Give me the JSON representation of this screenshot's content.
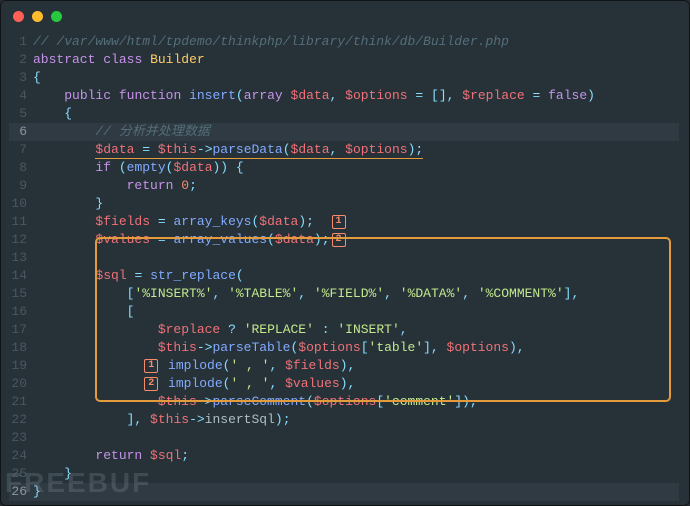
{
  "watermark": "FREEBUF",
  "lines": [
    {
      "n": 1,
      "tokens": [
        [
          "cmt",
          "// /var/www/html/tpdemo/thinkphp/library/think/db/Builder.php"
        ]
      ]
    },
    {
      "n": 2,
      "tokens": [
        [
          "kw",
          "abstract"
        ],
        [
          "txt",
          " "
        ],
        [
          "kw",
          "class"
        ],
        [
          "txt",
          " "
        ],
        [
          "cls",
          "Builder"
        ]
      ]
    },
    {
      "n": 3,
      "tokens": [
        [
          "pun",
          "{"
        ]
      ]
    },
    {
      "n": 4,
      "tokens": [
        [
          "txt",
          "    "
        ],
        [
          "kw",
          "public"
        ],
        [
          "txt",
          " "
        ],
        [
          "kw",
          "function"
        ],
        [
          "txt",
          " "
        ],
        [
          "fn",
          "insert"
        ],
        [
          "pun",
          "("
        ],
        [
          "kw",
          "array"
        ],
        [
          "txt",
          " "
        ],
        [
          "var",
          "$data"
        ],
        [
          "pun",
          ","
        ],
        [
          "txt",
          " "
        ],
        [
          "var",
          "$options"
        ],
        [
          "txt",
          " "
        ],
        [
          "op",
          "="
        ],
        [
          "txt",
          " "
        ],
        [
          "pun",
          "[]"
        ],
        [
          "pun",
          ","
        ],
        [
          "txt",
          " "
        ],
        [
          "var",
          "$replace"
        ],
        [
          "txt",
          " "
        ],
        [
          "op",
          "="
        ],
        [
          "txt",
          " "
        ],
        [
          "kw",
          "false"
        ],
        [
          "pun",
          ")"
        ]
      ]
    },
    {
      "n": 5,
      "tokens": [
        [
          "txt",
          "    "
        ],
        [
          "pun",
          "{"
        ]
      ]
    },
    {
      "n": 6,
      "active": true,
      "tokens": [
        [
          "txt",
          "        "
        ],
        [
          "cmt",
          "// 分析并处理数据"
        ]
      ]
    },
    {
      "n": 7,
      "tokens": [
        [
          "txt",
          "        "
        ],
        [
          "ul_start",
          ""
        ],
        [
          "var",
          "$data"
        ],
        [
          "txt",
          " "
        ],
        [
          "op",
          "="
        ],
        [
          "txt",
          " "
        ],
        [
          "var",
          "$this"
        ],
        [
          "op",
          "->"
        ],
        [
          "fn",
          "parseData"
        ],
        [
          "pun",
          "("
        ],
        [
          "var",
          "$data"
        ],
        [
          "pun",
          ","
        ],
        [
          "txt",
          " "
        ],
        [
          "var",
          "$options"
        ],
        [
          "pun",
          ")"
        ],
        [
          "pun",
          ";"
        ],
        [
          "ul_end",
          ""
        ]
      ]
    },
    {
      "n": 8,
      "tokens": [
        [
          "txt",
          "        "
        ],
        [
          "kw",
          "if"
        ],
        [
          "txt",
          " "
        ],
        [
          "pun",
          "("
        ],
        [
          "fn",
          "empty"
        ],
        [
          "pun",
          "("
        ],
        [
          "var",
          "$data"
        ],
        [
          "pun",
          "))"
        ],
        [
          "txt",
          " "
        ],
        [
          "pun",
          "{"
        ]
      ]
    },
    {
      "n": 9,
      "tokens": [
        [
          "txt",
          "            "
        ],
        [
          "kw",
          "return"
        ],
        [
          "txt",
          " "
        ],
        [
          "num",
          "0"
        ],
        [
          "pun",
          ";"
        ]
      ]
    },
    {
      "n": 10,
      "tokens": [
        [
          "txt",
          "        "
        ],
        [
          "pun",
          "}"
        ]
      ]
    },
    {
      "n": 11,
      "tokens": [
        [
          "txt",
          "        "
        ],
        [
          "var",
          "$fields"
        ],
        [
          "txt",
          " "
        ],
        [
          "op",
          "="
        ],
        [
          "txt",
          " "
        ],
        [
          "fn",
          "array_keys"
        ],
        [
          "pun",
          "("
        ],
        [
          "var",
          "$data"
        ],
        [
          "pun",
          ")"
        ],
        [
          "pun",
          ";"
        ],
        [
          "txt",
          "  "
        ],
        [
          "marker",
          "1"
        ]
      ]
    },
    {
      "n": 12,
      "tokens": [
        [
          "txt",
          "        "
        ],
        [
          "var",
          "$values"
        ],
        [
          "txt",
          " "
        ],
        [
          "op",
          "="
        ],
        [
          "txt",
          " "
        ],
        [
          "fn",
          "array_values"
        ],
        [
          "pun",
          "("
        ],
        [
          "var",
          "$data"
        ],
        [
          "pun",
          ")"
        ],
        [
          "pun",
          ";"
        ],
        [
          "marker",
          "2"
        ]
      ]
    },
    {
      "n": 13,
      "tokens": [
        [
          "txt",
          " "
        ]
      ]
    },
    {
      "n": 14,
      "tokens": [
        [
          "txt",
          "        "
        ],
        [
          "var",
          "$sql"
        ],
        [
          "txt",
          " "
        ],
        [
          "op",
          "="
        ],
        [
          "txt",
          " "
        ],
        [
          "fn",
          "str_replace"
        ],
        [
          "pun",
          "("
        ]
      ]
    },
    {
      "n": 15,
      "tokens": [
        [
          "txt",
          "            "
        ],
        [
          "pun",
          "["
        ],
        [
          "str",
          "'%INSERT%'"
        ],
        [
          "pun",
          ","
        ],
        [
          "txt",
          " "
        ],
        [
          "str",
          "'%TABLE%'"
        ],
        [
          "pun",
          ","
        ],
        [
          "txt",
          " "
        ],
        [
          "str",
          "'%FIELD%'"
        ],
        [
          "pun",
          ","
        ],
        [
          "txt",
          " "
        ],
        [
          "str",
          "'%DATA%'"
        ],
        [
          "pun",
          ","
        ],
        [
          "txt",
          " "
        ],
        [
          "str",
          "'%COMMENT%'"
        ],
        [
          "pun",
          "],"
        ]
      ]
    },
    {
      "n": 16,
      "tokens": [
        [
          "txt",
          "            "
        ],
        [
          "pun",
          "["
        ]
      ]
    },
    {
      "n": 17,
      "tokens": [
        [
          "txt",
          "                "
        ],
        [
          "var",
          "$replace"
        ],
        [
          "txt",
          " "
        ],
        [
          "op",
          "?"
        ],
        [
          "txt",
          " "
        ],
        [
          "str",
          "'REPLACE'"
        ],
        [
          "txt",
          " "
        ],
        [
          "op",
          ":"
        ],
        [
          "txt",
          " "
        ],
        [
          "str",
          "'INSERT'"
        ],
        [
          "pun",
          ","
        ]
      ]
    },
    {
      "n": 18,
      "tokens": [
        [
          "txt",
          "                "
        ],
        [
          "var",
          "$this"
        ],
        [
          "op",
          "->"
        ],
        [
          "fn",
          "parseTable"
        ],
        [
          "pun",
          "("
        ],
        [
          "var",
          "$options"
        ],
        [
          "pun",
          "["
        ],
        [
          "str",
          "'table'"
        ],
        [
          "pun",
          "],"
        ],
        [
          "txt",
          " "
        ],
        [
          "var",
          "$options"
        ],
        [
          "pun",
          "),"
        ]
      ]
    },
    {
      "n": 19,
      "tokens": [
        [
          "txt",
          "              "
        ],
        [
          "marker",
          "1"
        ],
        [
          "txt",
          " "
        ],
        [
          "fn",
          "implode"
        ],
        [
          "pun",
          "("
        ],
        [
          "str",
          "' , '"
        ],
        [
          "pun",
          ","
        ],
        [
          "txt",
          " "
        ],
        [
          "var",
          "$fields"
        ],
        [
          "pun",
          "),"
        ]
      ]
    },
    {
      "n": 20,
      "tokens": [
        [
          "txt",
          "              "
        ],
        [
          "marker",
          "2"
        ],
        [
          "txt",
          " "
        ],
        [
          "fn",
          "implode"
        ],
        [
          "pun",
          "("
        ],
        [
          "str",
          "' , '"
        ],
        [
          "pun",
          ","
        ],
        [
          "txt",
          " "
        ],
        [
          "var",
          "$values"
        ],
        [
          "pun",
          "),"
        ]
      ]
    },
    {
      "n": 21,
      "tokens": [
        [
          "txt",
          "                "
        ],
        [
          "var",
          "$this"
        ],
        [
          "op",
          "->"
        ],
        [
          "fn",
          "parseComment"
        ],
        [
          "pun",
          "("
        ],
        [
          "var",
          "$options"
        ],
        [
          "pun",
          "["
        ],
        [
          "str",
          "'comment'"
        ],
        [
          "pun",
          "]),"
        ]
      ]
    },
    {
      "n": 22,
      "tokens": [
        [
          "txt",
          "            "
        ],
        [
          "pun",
          "],"
        ],
        [
          "txt",
          " "
        ],
        [
          "var",
          "$this"
        ],
        [
          "op",
          "->"
        ],
        [
          "txt",
          "insertSql"
        ],
        [
          "pun",
          ");"
        ]
      ]
    },
    {
      "n": 23,
      "tokens": [
        [
          "txt",
          " "
        ]
      ]
    },
    {
      "n": 24,
      "tokens": [
        [
          "txt",
          "        "
        ],
        [
          "kw",
          "return"
        ],
        [
          "txt",
          " "
        ],
        [
          "var",
          "$sql"
        ],
        [
          "pun",
          ";"
        ]
      ]
    },
    {
      "n": 25,
      "tokens": [
        [
          "txt",
          "    "
        ],
        [
          "pun",
          "}"
        ]
      ]
    },
    {
      "n": 26,
      "active": true,
      "tokens": [
        [
          "pun",
          "}"
        ]
      ]
    }
  ]
}
